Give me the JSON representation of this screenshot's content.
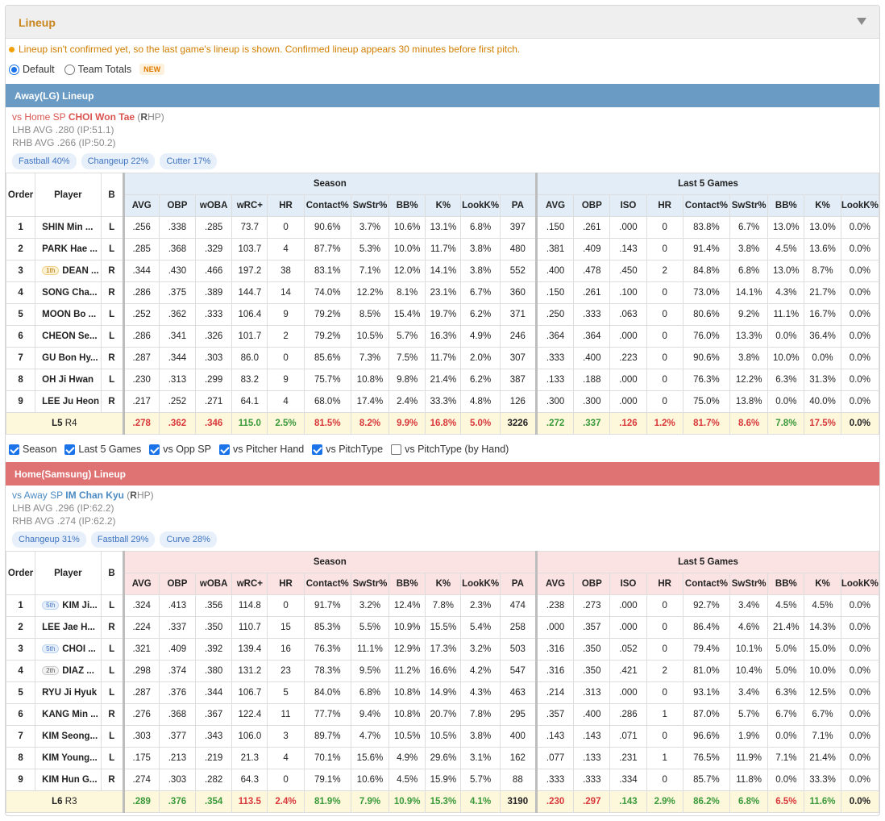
{
  "header": {
    "title": "Lineup"
  },
  "notice": "Lineup isn't confirmed yet, so the last game's lineup is shown. Confirmed lineup appears 30 minutes before first pitch.",
  "view": {
    "default_label": "Default",
    "team_totals_label": "Team Totals",
    "new_badge": "NEW",
    "selected": "Default"
  },
  "cols": {
    "order": "Order",
    "player": "Player",
    "bat": "B",
    "season": "Season",
    "last5": "Last 5 Games",
    "season_cols": [
      "AVG",
      "OBP",
      "wOBA",
      "wRC+",
      "HR",
      "Contact%",
      "SwStr%",
      "BB%",
      "K%",
      "LookK%",
      "PA"
    ],
    "last5_cols": [
      "AVG",
      "OBP",
      "ISO",
      "HR",
      "Contact%",
      "SwStr%",
      "BB%",
      "K%",
      "LookK%"
    ]
  },
  "away": {
    "title": "Away(LG) Lineup",
    "sp_prefix": "vs Home SP",
    "sp_name": "CHOI Won Tae",
    "sp_hand_open": "(",
    "sp_hand_bold": "R",
    "sp_hand_rest": "HP)",
    "lhb": "LHB AVG .280 (IP:51.1)",
    "rhb": "RHB AVG .266 (IP:50.2)",
    "pitches": [
      "Fastball 40%",
      "Changeup 22%",
      "Cutter 17%"
    ],
    "rows": [
      {
        "order": "1",
        "tag": "",
        "name": "SHIN Min ...",
        "b": "L",
        "season": [
          ".256",
          ".338",
          ".285",
          "73.7",
          "0",
          "90.6%",
          "3.7%",
          "10.6%",
          "13.1%",
          "6.8%",
          "397"
        ],
        "last5": [
          ".150",
          ".261",
          ".000",
          "0",
          "83.8%",
          "6.7%",
          "13.0%",
          "13.0%",
          "0.0%"
        ]
      },
      {
        "order": "2",
        "tag": "",
        "name": "PARK Hae ...",
        "b": "L",
        "season": [
          ".285",
          ".368",
          ".329",
          "103.7",
          "4",
          "87.7%",
          "5.3%",
          "10.0%",
          "11.7%",
          "3.8%",
          "480"
        ],
        "last5": [
          ".381",
          ".409",
          ".143",
          "0",
          "91.4%",
          "3.8%",
          "4.5%",
          "13.6%",
          "0.0%"
        ]
      },
      {
        "order": "3",
        "tag": "1th",
        "name": "DEAN ...",
        "b": "R",
        "season": [
          ".344",
          ".430",
          ".466",
          "197.2",
          "38",
          "83.1%",
          "7.1%",
          "12.0%",
          "14.1%",
          "3.8%",
          "552"
        ],
        "last5": [
          ".400",
          ".478",
          ".450",
          "2",
          "84.8%",
          "6.8%",
          "13.0%",
          "8.7%",
          "0.0%"
        ]
      },
      {
        "order": "4",
        "tag": "",
        "name": "SONG Cha...",
        "b": "R",
        "season": [
          ".286",
          ".375",
          ".389",
          "144.7",
          "14",
          "74.0%",
          "12.2%",
          "8.1%",
          "23.1%",
          "6.7%",
          "360"
        ],
        "last5": [
          ".150",
          ".261",
          ".100",
          "0",
          "73.0%",
          "14.1%",
          "4.3%",
          "21.7%",
          "0.0%"
        ]
      },
      {
        "order": "5",
        "tag": "",
        "name": "MOON Bo ...",
        "b": "L",
        "season": [
          ".252",
          ".362",
          ".333",
          "106.4",
          "9",
          "79.2%",
          "8.5%",
          "15.4%",
          "19.7%",
          "6.2%",
          "371"
        ],
        "last5": [
          ".250",
          ".333",
          ".063",
          "0",
          "80.6%",
          "9.2%",
          "11.1%",
          "16.7%",
          "0.0%"
        ]
      },
      {
        "order": "6",
        "tag": "",
        "name": "CHEON Se...",
        "b": "L",
        "season": [
          ".286",
          ".341",
          ".326",
          "101.7",
          "2",
          "79.2%",
          "10.5%",
          "5.7%",
          "16.3%",
          "4.9%",
          "246"
        ],
        "last5": [
          ".364",
          ".364",
          ".000",
          "0",
          "76.0%",
          "13.3%",
          "0.0%",
          "36.4%",
          "0.0%"
        ]
      },
      {
        "order": "7",
        "tag": "",
        "name": "GU Bon Hy...",
        "b": "R",
        "season": [
          ".287",
          ".344",
          ".303",
          "86.0",
          "0",
          "85.6%",
          "7.3%",
          "7.5%",
          "11.7%",
          "2.0%",
          "307"
        ],
        "last5": [
          ".333",
          ".400",
          ".223",
          "0",
          "90.6%",
          "3.8%",
          "10.0%",
          "0.0%",
          "0.0%"
        ]
      },
      {
        "order": "8",
        "tag": "",
        "name": "OH Ji Hwan",
        "b": "L",
        "season": [
          ".230",
          ".313",
          ".299",
          "83.2",
          "9",
          "75.7%",
          "10.8%",
          "9.8%",
          "21.4%",
          "6.2%",
          "387"
        ],
        "last5": [
          ".133",
          ".188",
          ".000",
          "0",
          "76.3%",
          "12.2%",
          "6.3%",
          "31.3%",
          "0.0%"
        ]
      },
      {
        "order": "9",
        "tag": "",
        "name": "LEE Ju Heon",
        "b": "R",
        "season": [
          ".217",
          ".252",
          ".271",
          "64.1",
          "4",
          "68.0%",
          "17.4%",
          "2.4%",
          "33.3%",
          "4.8%",
          "126"
        ],
        "last5": [
          ".300",
          ".300",
          ".000",
          "0",
          "75.0%",
          "13.8%",
          "0.0%",
          "40.0%",
          "0.0%"
        ]
      }
    ],
    "total": {
      "label_bold": "L5",
      "label_rest": "R4",
      "season": [
        ".278",
        ".362",
        ".346",
        "115.0",
        "2.5%",
        "81.5%",
        "8.2%",
        "9.9%",
        "16.8%",
        "5.0%",
        "3226"
      ],
      "season_colors": [
        "r",
        "r",
        "r",
        "gr",
        "gr",
        "r",
        "r",
        "r",
        "r",
        "r",
        "bk"
      ],
      "last5": [
        ".272",
        ".337",
        ".126",
        "1.2%",
        "81.7%",
        "8.6%",
        "7.8%",
        "17.5%",
        "0.0%"
      ],
      "last5_colors": [
        "gr",
        "gr",
        "r",
        "r",
        "r",
        "r",
        "gr",
        "r",
        "bk"
      ]
    }
  },
  "filters": [
    {
      "label": "Season",
      "checked": true
    },
    {
      "label": "Last 5 Games",
      "checked": true
    },
    {
      "label": "vs Opp SP",
      "checked": true
    },
    {
      "label": "vs Pitcher Hand",
      "checked": true
    },
    {
      "label": "vs PitchType",
      "checked": true
    },
    {
      "label": "vs PitchType (by Hand)",
      "checked": false
    }
  ],
  "home": {
    "title": "Home(Samsung) Lineup",
    "sp_prefix": "vs Away SP",
    "sp_name": "IM Chan Kyu",
    "sp_hand_open": "(",
    "sp_hand_bold": "R",
    "sp_hand_rest": "HP)",
    "lhb": "LHB AVG .296 (IP:62.2)",
    "rhb": "RHB AVG .274 (IP:62.2)",
    "pitches": [
      "Changeup 31%",
      "Fastball 29%",
      "Curve 28%"
    ],
    "rows": [
      {
        "order": "1",
        "tag": "5th",
        "tagc": "blue",
        "name": "KIM Ji...",
        "b": "L",
        "season": [
          ".324",
          ".413",
          ".356",
          "114.8",
          "0",
          "91.7%",
          "3.2%",
          "12.4%",
          "7.8%",
          "2.3%",
          "474"
        ],
        "last5": [
          ".238",
          ".273",
          ".000",
          "0",
          "92.7%",
          "3.4%",
          "4.5%",
          "4.5%",
          "0.0%"
        ]
      },
      {
        "order": "2",
        "tag": "",
        "name": "LEE Jae H...",
        "b": "R",
        "season": [
          ".224",
          ".337",
          ".350",
          "110.7",
          "15",
          "85.3%",
          "5.5%",
          "10.9%",
          "15.5%",
          "5.4%",
          "258"
        ],
        "last5": [
          ".000",
          ".357",
          ".000",
          "0",
          "86.4%",
          "4.6%",
          "21.4%",
          "14.3%",
          "0.0%"
        ]
      },
      {
        "order": "3",
        "tag": "5th",
        "tagc": "blue",
        "name": "CHOI ...",
        "b": "L",
        "season": [
          ".321",
          ".409",
          ".392",
          "139.4",
          "16",
          "76.3%",
          "11.1%",
          "12.9%",
          "17.3%",
          "3.2%",
          "503"
        ],
        "last5": [
          ".316",
          ".350",
          ".052",
          "0",
          "79.4%",
          "10.1%",
          "5.0%",
          "15.0%",
          "0.0%"
        ]
      },
      {
        "order": "4",
        "tag": "2th",
        "tagc": "",
        "name": "DIAZ ...",
        "b": "L",
        "season": [
          ".298",
          ".374",
          ".380",
          "131.2",
          "23",
          "78.3%",
          "9.5%",
          "11.2%",
          "16.6%",
          "4.2%",
          "547"
        ],
        "last5": [
          ".316",
          ".350",
          ".421",
          "2",
          "81.0%",
          "10.4%",
          "5.0%",
          "10.0%",
          "0.0%"
        ]
      },
      {
        "order": "5",
        "tag": "",
        "name": "RYU Ji Hyuk",
        "b": "L",
        "season": [
          ".287",
          ".376",
          ".344",
          "106.7",
          "5",
          "84.0%",
          "6.8%",
          "10.8%",
          "14.9%",
          "4.3%",
          "463"
        ],
        "last5": [
          ".214",
          ".313",
          ".000",
          "0",
          "93.1%",
          "3.4%",
          "6.3%",
          "12.5%",
          "0.0%"
        ]
      },
      {
        "order": "6",
        "tag": "",
        "name": "KANG Min ...",
        "b": "R",
        "season": [
          ".276",
          ".368",
          ".367",
          "122.4",
          "11",
          "77.7%",
          "9.4%",
          "10.8%",
          "20.7%",
          "7.8%",
          "295"
        ],
        "last5": [
          ".357",
          ".400",
          ".286",
          "1",
          "87.0%",
          "5.7%",
          "6.7%",
          "6.7%",
          "0.0%"
        ]
      },
      {
        "order": "7",
        "tag": "",
        "name": "KIM Seong...",
        "b": "L",
        "season": [
          ".303",
          ".377",
          ".343",
          "106.0",
          "3",
          "89.7%",
          "4.7%",
          "10.5%",
          "10.5%",
          "3.8%",
          "400"
        ],
        "last5": [
          ".143",
          ".143",
          ".071",
          "0",
          "96.6%",
          "1.9%",
          "0.0%",
          "7.1%",
          "0.0%"
        ]
      },
      {
        "order": "8",
        "tag": "",
        "name": "KIM Young...",
        "b": "L",
        "season": [
          ".175",
          ".213",
          ".219",
          "21.3",
          "4",
          "70.1%",
          "15.6%",
          "4.9%",
          "29.6%",
          "3.1%",
          "162"
        ],
        "last5": [
          ".077",
          ".133",
          ".231",
          "1",
          "76.5%",
          "11.9%",
          "7.1%",
          "21.4%",
          "0.0%"
        ]
      },
      {
        "order": "9",
        "tag": "",
        "name": "KIM Hun G...",
        "b": "R",
        "season": [
          ".274",
          ".303",
          ".282",
          "64.3",
          "0",
          "79.1%",
          "10.6%",
          "4.5%",
          "15.9%",
          "5.7%",
          "88"
        ],
        "last5": [
          ".333",
          ".333",
          ".334",
          "0",
          "85.7%",
          "11.8%",
          "0.0%",
          "33.3%",
          "0.0%"
        ]
      }
    ],
    "total": {
      "label_bold": "L6",
      "label_rest": "R3",
      "season": [
        ".289",
        ".376",
        ".354",
        "113.5",
        "2.4%",
        "81.9%",
        "7.9%",
        "10.9%",
        "15.3%",
        "4.1%",
        "3190"
      ],
      "season_colors": [
        "gr",
        "gr",
        "gr",
        "r",
        "r",
        "gr",
        "gr",
        "gr",
        "gr",
        "gr",
        "bk"
      ],
      "last5": [
        ".230",
        ".297",
        ".143",
        "2.9%",
        "86.2%",
        "6.8%",
        "6.5%",
        "11.6%",
        "0.0%"
      ],
      "last5_colors": [
        "r",
        "r",
        "gr",
        "gr",
        "gr",
        "gr",
        "r",
        "gr",
        "bk"
      ]
    }
  }
}
